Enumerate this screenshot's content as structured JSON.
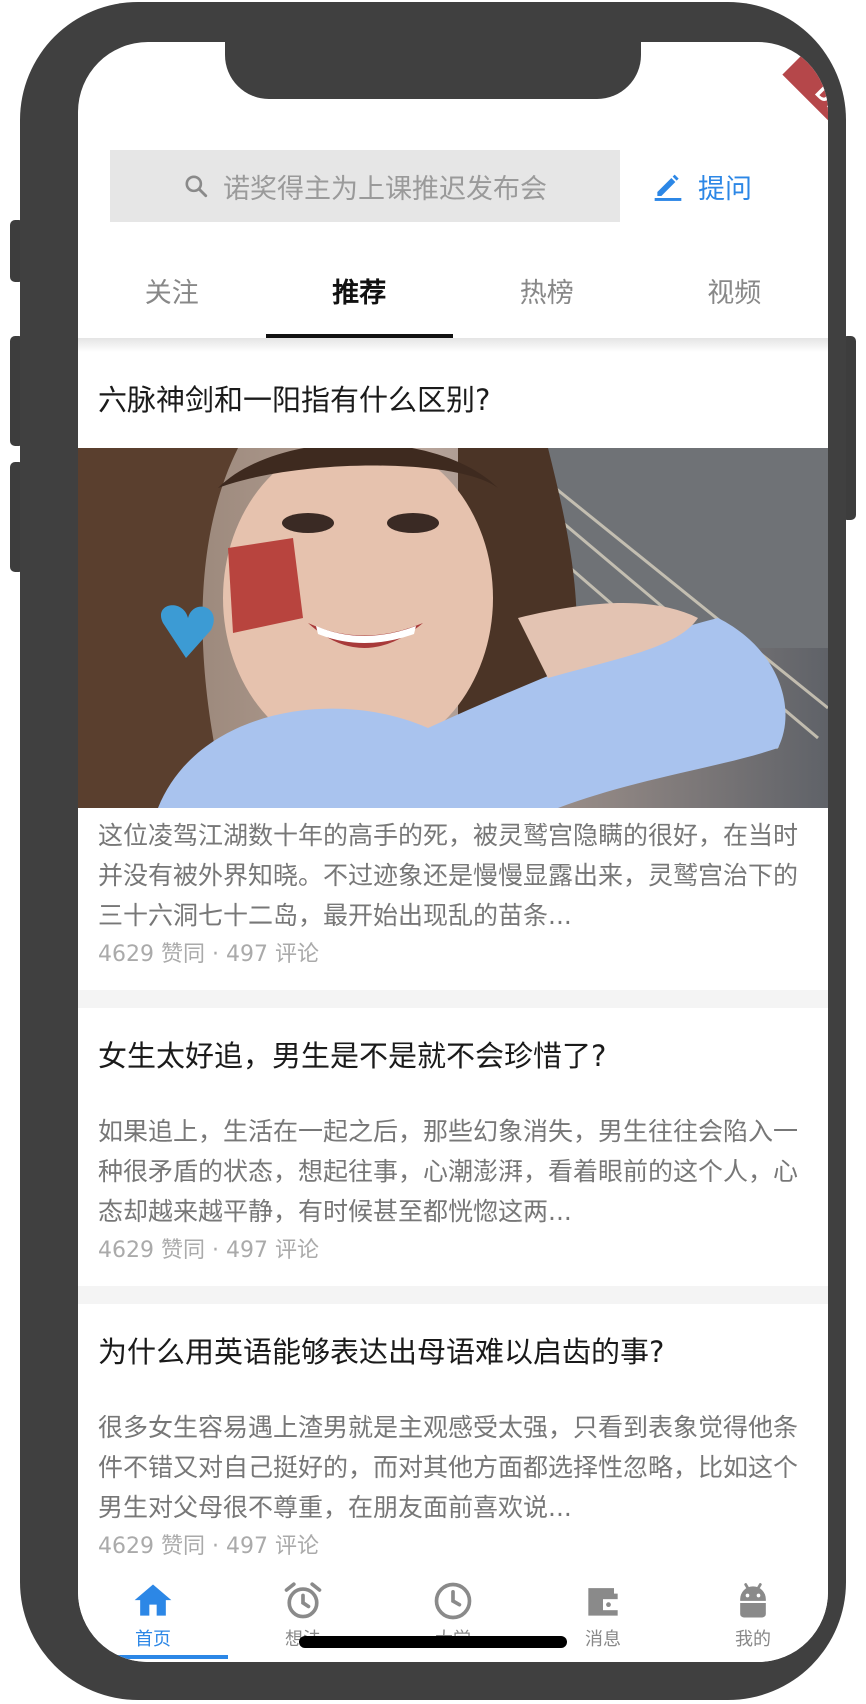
{
  "debug_banner": "DEBUG",
  "search": {
    "placeholder_text": "诺奖得主为上课推迟发布会",
    "icon": "search-icon"
  },
  "ask_button": {
    "label": "提问",
    "icon": "pencil-icon"
  },
  "tabs": [
    {
      "label": "关注",
      "active": false
    },
    {
      "label": "推荐",
      "active": true
    },
    {
      "label": "热榜",
      "active": false
    },
    {
      "label": "视频",
      "active": false
    }
  ],
  "feed": [
    {
      "title": "六脉神剑和一阳指有什么区别?",
      "has_image": true,
      "body": "这位凌驾江湖数十年的高手的死，被灵鹫宫隐瞒的很好，在当时并没有被外界知晓。不过迹象还是慢慢显露出来，灵鹫宫治下的三十六洞七十二岛，最开始出现乱的苗条...",
      "meta": "4629 赞同 · 497 评论"
    },
    {
      "title": "女生太好追，男生是不是就不会珍惜了?",
      "has_image": false,
      "body": "如果追上，生活在一起之后，那些幻象消失，男生往往会陷入一种很矛盾的状态，想起往事，心潮澎湃，看着眼前的这个人，心态却越来越平静，有时候甚至都恍惚这两...",
      "meta": "4629 赞同 · 497 评论"
    },
    {
      "title": "为什么用英语能够表达出母语难以启齿的事?",
      "has_image": false,
      "body": "很多女生容易遇上渣男就是主观感受太强，只看到表象觉得他条件不错又对自己挺好的，而对其他方面都选择性忽略，比如这个男生对父母很不尊重，在朋友面前喜欢说...",
      "meta": "4629 赞同 · 497 评论"
    }
  ],
  "bottom_nav": [
    {
      "label": "首页",
      "icon": "home-icon",
      "active": true
    },
    {
      "label": "想法",
      "icon": "alarm-clock-icon",
      "active": false
    },
    {
      "label": "大学",
      "icon": "clock-icon",
      "active": false
    },
    {
      "label": "消息",
      "icon": "wallet-icon",
      "active": false
    },
    {
      "label": "我的",
      "icon": "android-icon",
      "active": false
    }
  ],
  "colors": {
    "accent": "#2c87e6",
    "frame": "#404040",
    "debug": "#b5474a"
  }
}
